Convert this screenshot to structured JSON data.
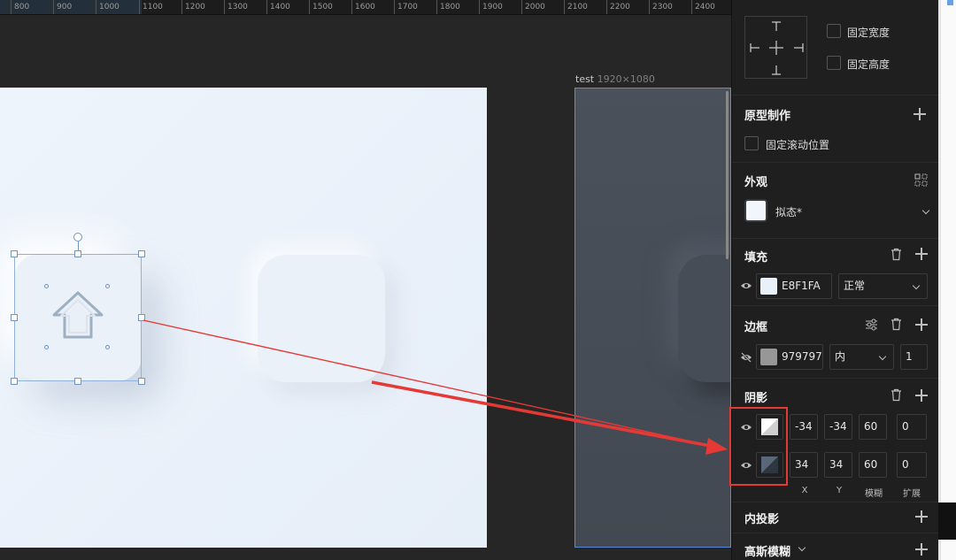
{
  "ruler": {
    "ticks": [
      "800",
      "900",
      "1000",
      "1100",
      "1200",
      "1300",
      "1400",
      "1500",
      "1600",
      "1700",
      "1800",
      "1900",
      "2000",
      "2100",
      "2200",
      "2300",
      "2400"
    ]
  },
  "canvas": {
    "frame_name": "test",
    "frame_size": "1920×1080"
  },
  "constraints": {
    "fixed_width_label": "固定宽度",
    "fixed_height_label": "固定高度"
  },
  "prototype": {
    "title": "原型制作",
    "fixed_scroll_label": "固定滚动位置"
  },
  "appearance": {
    "title": "外观",
    "style_name": "拟态*"
  },
  "fill": {
    "title": "填充",
    "hex": "E8F1FA",
    "blend_mode": "正常",
    "color": "#E8F1FA"
  },
  "border": {
    "title": "边框",
    "hex": "979797",
    "position": "内",
    "width": "1",
    "color": "#979797"
  },
  "shadow": {
    "title": "阴影",
    "rows": [
      {
        "x": "-34",
        "y": "-34",
        "blur": "60",
        "spread": "0"
      },
      {
        "x": "34",
        "y": "34",
        "blur": "60",
        "spread": "0"
      }
    ],
    "labels": {
      "x": "X",
      "y": "Y",
      "blur": "模糊",
      "spread": "扩展"
    }
  },
  "inner_shadow": {
    "title": "内投影"
  },
  "gaussian_blur": {
    "title": "高斯模糊"
  },
  "colors": {
    "selection": "#6f95c4",
    "frame_border": "#5b8bd6",
    "annotation": "#e53935"
  }
}
